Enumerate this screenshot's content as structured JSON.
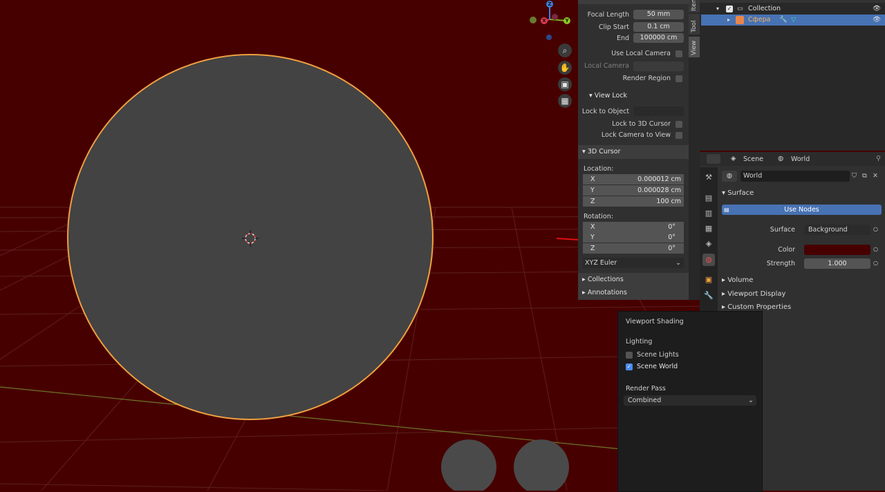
{
  "npanel": {
    "tabs": [
      "Item",
      "Tool",
      "View"
    ],
    "view": {
      "focal_length_label": "Focal Length",
      "focal_length": "50 mm",
      "clip_start_label": "Clip Start",
      "clip_start": "0.1 cm",
      "clip_end_label": "End",
      "clip_end": "100000 cm",
      "use_local_camera": "Use Local Camera",
      "local_camera": "Local Camera",
      "render_region": "Render Region"
    },
    "view_lock": {
      "title": "View Lock",
      "lock_to_object": "Lock to Object",
      "lock_to_3d_cursor": "Lock to 3D Cursor",
      "lock_camera_to_view": "Lock Camera to View"
    },
    "cursor": {
      "title": "3D Cursor",
      "location_label": "Location:",
      "location": [
        {
          "axis": "X",
          "value": "0.000012 cm"
        },
        {
          "axis": "Y",
          "value": "0.000028 cm"
        },
        {
          "axis": "Z",
          "value": "100 cm"
        }
      ],
      "rotation_label": "Rotation:",
      "rotation": [
        {
          "axis": "X",
          "value": "0°"
        },
        {
          "axis": "Y",
          "value": "0°"
        },
        {
          "axis": "Z",
          "value": "0°"
        }
      ],
      "rotation_mode": "XYZ Euler"
    },
    "collections": "Collections",
    "annotations": "Annotations"
  },
  "outliner": {
    "collection": "Collection",
    "object": "Сфера"
  },
  "properties": {
    "scene": "Scene",
    "world_crumb": "World",
    "world_name": "World",
    "surface_section": "Surface",
    "use_nodes": "Use Nodes",
    "surface_label": "Surface",
    "surface_value": "Background",
    "color_label": "Color",
    "color_value": "#470000",
    "strength_label": "Strength",
    "strength_value": "1.000",
    "volume": "Volume",
    "viewport_display": "Viewport Display",
    "custom_properties": "Custom Properties"
  },
  "shading": {
    "title": "Viewport Shading",
    "lighting": "Lighting",
    "scene_lights": "Scene Lights",
    "scene_world": "Scene World",
    "render_pass": "Render Pass",
    "render_pass_value": "Combined"
  },
  "gizmo": {
    "x": "X",
    "y": "Y",
    "z": "Z"
  },
  "colors": {
    "world": "#470000",
    "accent": "#4772b3",
    "selection": "#f0a040",
    "annotation": "#e01010"
  }
}
